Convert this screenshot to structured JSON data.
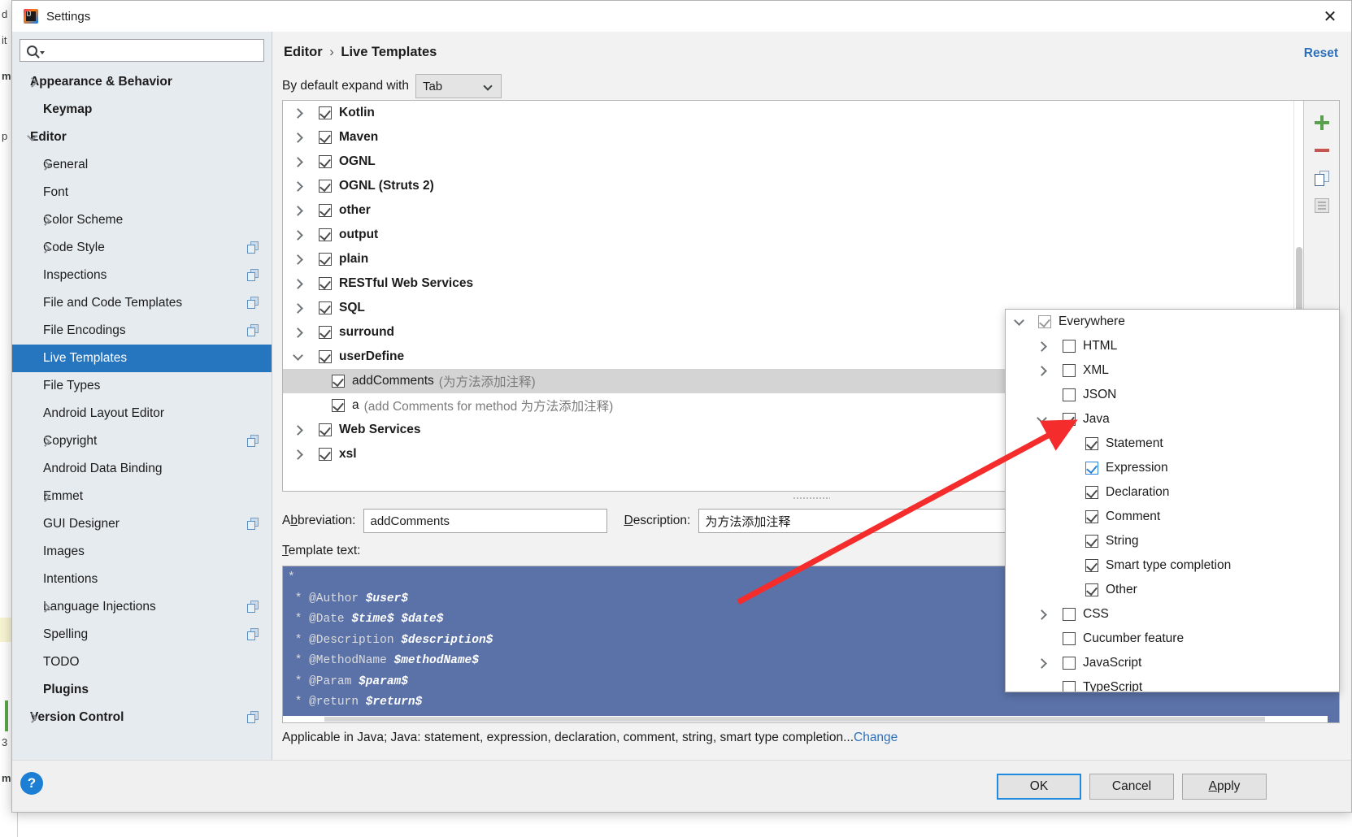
{
  "background": {
    "fragments": [
      "d",
      "it",
      "m",
      "p",
      "3",
      "m"
    ]
  },
  "window": {
    "title": "Settings",
    "logo_icon": "intellij-idea-logo",
    "close_icon": "close-icon"
  },
  "sidebar": {
    "search": {
      "placeholder": "",
      "value": "",
      "icon": "search-icon"
    },
    "items": [
      {
        "label": "Appearance & Behavior",
        "level": 0,
        "arrow": "right",
        "bold": true,
        "selected": false,
        "copyable": false
      },
      {
        "label": "Keymap",
        "level": 1,
        "arrow": "none",
        "bold": true,
        "selected": false,
        "copyable": false
      },
      {
        "label": "Editor",
        "level": 0,
        "arrow": "down",
        "bold": true,
        "selected": false,
        "copyable": false
      },
      {
        "label": "General",
        "level": 1,
        "arrow": "right",
        "bold": false,
        "selected": false,
        "copyable": false
      },
      {
        "label": "Font",
        "level": 1,
        "arrow": "none",
        "bold": false,
        "selected": false,
        "copyable": false
      },
      {
        "label": "Color Scheme",
        "level": 1,
        "arrow": "right",
        "bold": false,
        "selected": false,
        "copyable": false
      },
      {
        "label": "Code Style",
        "level": 1,
        "arrow": "right",
        "bold": false,
        "selected": false,
        "copyable": true
      },
      {
        "label": "Inspections",
        "level": 1,
        "arrow": "none",
        "bold": false,
        "selected": false,
        "copyable": true
      },
      {
        "label": "File and Code Templates",
        "level": 1,
        "arrow": "none",
        "bold": false,
        "selected": false,
        "copyable": true
      },
      {
        "label": "File Encodings",
        "level": 1,
        "arrow": "none",
        "bold": false,
        "selected": false,
        "copyable": true
      },
      {
        "label": "Live Templates",
        "level": 1,
        "arrow": "none",
        "bold": false,
        "selected": true,
        "copyable": false
      },
      {
        "label": "File Types",
        "level": 1,
        "arrow": "none",
        "bold": false,
        "selected": false,
        "copyable": false
      },
      {
        "label": "Android Layout Editor",
        "level": 1,
        "arrow": "none",
        "bold": false,
        "selected": false,
        "copyable": false
      },
      {
        "label": "Copyright",
        "level": 1,
        "arrow": "right",
        "bold": false,
        "selected": false,
        "copyable": true
      },
      {
        "label": "Android Data Binding",
        "level": 1,
        "arrow": "none",
        "bold": false,
        "selected": false,
        "copyable": false
      },
      {
        "label": "Emmet",
        "level": 1,
        "arrow": "right",
        "bold": false,
        "selected": false,
        "copyable": false
      },
      {
        "label": "GUI Designer",
        "level": 1,
        "arrow": "none",
        "bold": false,
        "selected": false,
        "copyable": true
      },
      {
        "label": "Images",
        "level": 1,
        "arrow": "none",
        "bold": false,
        "selected": false,
        "copyable": false
      },
      {
        "label": "Intentions",
        "level": 1,
        "arrow": "none",
        "bold": false,
        "selected": false,
        "copyable": false
      },
      {
        "label": "Language Injections",
        "level": 1,
        "arrow": "right",
        "bold": false,
        "selected": false,
        "copyable": true
      },
      {
        "label": "Spelling",
        "level": 1,
        "arrow": "none",
        "bold": false,
        "selected": false,
        "copyable": true
      },
      {
        "label": "TODO",
        "level": 1,
        "arrow": "none",
        "bold": false,
        "selected": false,
        "copyable": false
      },
      {
        "label": "Plugins",
        "level": 1,
        "arrow": "none",
        "bold": true,
        "selected": false,
        "copyable": false
      },
      {
        "label": "Version Control",
        "level": 0,
        "arrow": "right",
        "bold": true,
        "selected": false,
        "copyable": true
      }
    ]
  },
  "main": {
    "breadcrumb": {
      "root": "Editor",
      "separator": "›",
      "leaf": "Live Templates"
    },
    "reset_label": "Reset",
    "expand": {
      "label": "By default expand with",
      "value": "Tab"
    },
    "templates": [
      {
        "label": "Kotlin",
        "desc": "",
        "level": 0,
        "arrow": "right",
        "checked": true,
        "selected": false
      },
      {
        "label": "Maven",
        "desc": "",
        "level": 0,
        "arrow": "right",
        "checked": true,
        "selected": false
      },
      {
        "label": "OGNL",
        "desc": "",
        "level": 0,
        "arrow": "right",
        "checked": true,
        "selected": false
      },
      {
        "label": "OGNL (Struts 2)",
        "desc": "",
        "level": 0,
        "arrow": "right",
        "checked": true,
        "selected": false
      },
      {
        "label": "other",
        "desc": "",
        "level": 0,
        "arrow": "right",
        "checked": true,
        "selected": false
      },
      {
        "label": "output",
        "desc": "",
        "level": 0,
        "arrow": "right",
        "checked": true,
        "selected": false
      },
      {
        "label": "plain",
        "desc": "",
        "level": 0,
        "arrow": "right",
        "checked": true,
        "selected": false
      },
      {
        "label": "RESTful Web Services",
        "desc": "",
        "level": 0,
        "arrow": "right",
        "checked": true,
        "selected": false
      },
      {
        "label": "SQL",
        "desc": "",
        "level": 0,
        "arrow": "right",
        "checked": true,
        "selected": false
      },
      {
        "label": "surround",
        "desc": "",
        "level": 0,
        "arrow": "right",
        "checked": true,
        "selected": false
      },
      {
        "label": "userDefine",
        "desc": "",
        "level": 0,
        "arrow": "down",
        "checked": true,
        "selected": false
      },
      {
        "label": "addComments",
        "desc": "(为方法添加注释)",
        "level": 1,
        "arrow": "none",
        "checked": true,
        "selected": true
      },
      {
        "label": "a",
        "desc": "(add Comments for method 为方法添加注释)",
        "level": 1,
        "arrow": "none",
        "checked": true,
        "selected": false
      },
      {
        "label": "Web Services",
        "desc": "",
        "level": 0,
        "arrow": "right",
        "checked": true,
        "selected": false
      },
      {
        "label": "xsl",
        "desc": "",
        "level": 0,
        "arrow": "right",
        "checked": true,
        "selected": false
      }
    ],
    "toolbar": [
      {
        "icon": "plus-icon",
        "name": "add-template-button"
      },
      {
        "icon": "minus-icon",
        "name": "remove-template-button"
      },
      {
        "icon": "copy-icon",
        "name": "duplicate-template-button"
      },
      {
        "icon": "document-icon",
        "name": "template-group-button"
      }
    ],
    "abbreviation": {
      "label": "Abbreviation:",
      "underline": "b",
      "value": "addComments"
    },
    "description": {
      "label": "Description:",
      "underline": "D",
      "value": "为方法添加注释"
    },
    "template_text": {
      "label": "Template text:",
      "underline": "T",
      "lines": [
        {
          "tokens": [
            {
              "t": "*",
              "v": false
            }
          ]
        },
        {
          "tokens": [
            {
              "t": " * @Author ",
              "v": false
            },
            {
              "t": "$user$",
              "v": true
            }
          ]
        },
        {
          "tokens": [
            {
              "t": " * @Date ",
              "v": false
            },
            {
              "t": "$time$ $date$",
              "v": true
            }
          ]
        },
        {
          "tokens": [
            {
              "t": " * @Description ",
              "v": false
            },
            {
              "t": "$description$",
              "v": true
            }
          ]
        },
        {
          "tokens": [
            {
              "t": " * @MethodName ",
              "v": false
            },
            {
              "t": "$methodName$",
              "v": true
            }
          ]
        },
        {
          "tokens": [
            {
              "t": " * @Param ",
              "v": false
            },
            {
              "t": "$param$",
              "v": true
            }
          ]
        },
        {
          "tokens": [
            {
              "t": " * @return ",
              "v": false
            },
            {
              "t": "$return$",
              "v": true
            }
          ]
        }
      ]
    },
    "applicable": {
      "text": "Applicable in Java; Java: statement, expression, declaration, comment, string, smart type completion...",
      "change_label": "Change"
    }
  },
  "popup": {
    "items": [
      {
        "label": "Everywhere",
        "level": 0,
        "arrow": "down",
        "checked": true,
        "style": "light",
        "focus": false
      },
      {
        "label": "HTML",
        "level": 1,
        "arrow": "right",
        "checked": false,
        "style": "normal",
        "focus": false
      },
      {
        "label": "XML",
        "level": 1,
        "arrow": "right",
        "checked": false,
        "style": "normal",
        "focus": false
      },
      {
        "label": "JSON",
        "level": 1,
        "arrow": "none",
        "checked": false,
        "style": "normal",
        "focus": false
      },
      {
        "label": "Java",
        "level": 1,
        "arrow": "down",
        "checked": true,
        "style": "normal",
        "focus": false
      },
      {
        "label": "Statement",
        "level": 2,
        "arrow": "none",
        "checked": true,
        "style": "normal",
        "focus": false
      },
      {
        "label": "Expression",
        "level": 2,
        "arrow": "none",
        "checked": true,
        "style": "normal",
        "focus": true
      },
      {
        "label": "Declaration",
        "level": 2,
        "arrow": "none",
        "checked": true,
        "style": "normal",
        "focus": false
      },
      {
        "label": "Comment",
        "level": 2,
        "arrow": "none",
        "checked": true,
        "style": "normal",
        "focus": false
      },
      {
        "label": "String",
        "level": 2,
        "arrow": "none",
        "checked": true,
        "style": "normal",
        "focus": false
      },
      {
        "label": "Smart type completion",
        "level": 2,
        "arrow": "none",
        "checked": true,
        "style": "normal",
        "focus": false
      },
      {
        "label": "Other",
        "level": 2,
        "arrow": "none",
        "checked": true,
        "style": "normal",
        "focus": false
      },
      {
        "label": "CSS",
        "level": 1,
        "arrow": "right",
        "checked": false,
        "style": "normal",
        "focus": false
      },
      {
        "label": "Cucumber feature",
        "level": 1,
        "arrow": "none",
        "checked": false,
        "style": "normal",
        "focus": false
      },
      {
        "label": "JavaScript",
        "level": 1,
        "arrow": "right",
        "checked": false,
        "style": "normal",
        "focus": false
      },
      {
        "label": "TypeScript",
        "level": 1,
        "arrow": "none",
        "checked": false,
        "style": "normal",
        "focus": false
      }
    ]
  },
  "footer": {
    "help_label": "?",
    "ok_label": "OK",
    "cancel_label": "Cancel",
    "apply_label": "Apply",
    "apply_underline": "A"
  },
  "annotation": {
    "arrow_color": "#f42c2c"
  }
}
